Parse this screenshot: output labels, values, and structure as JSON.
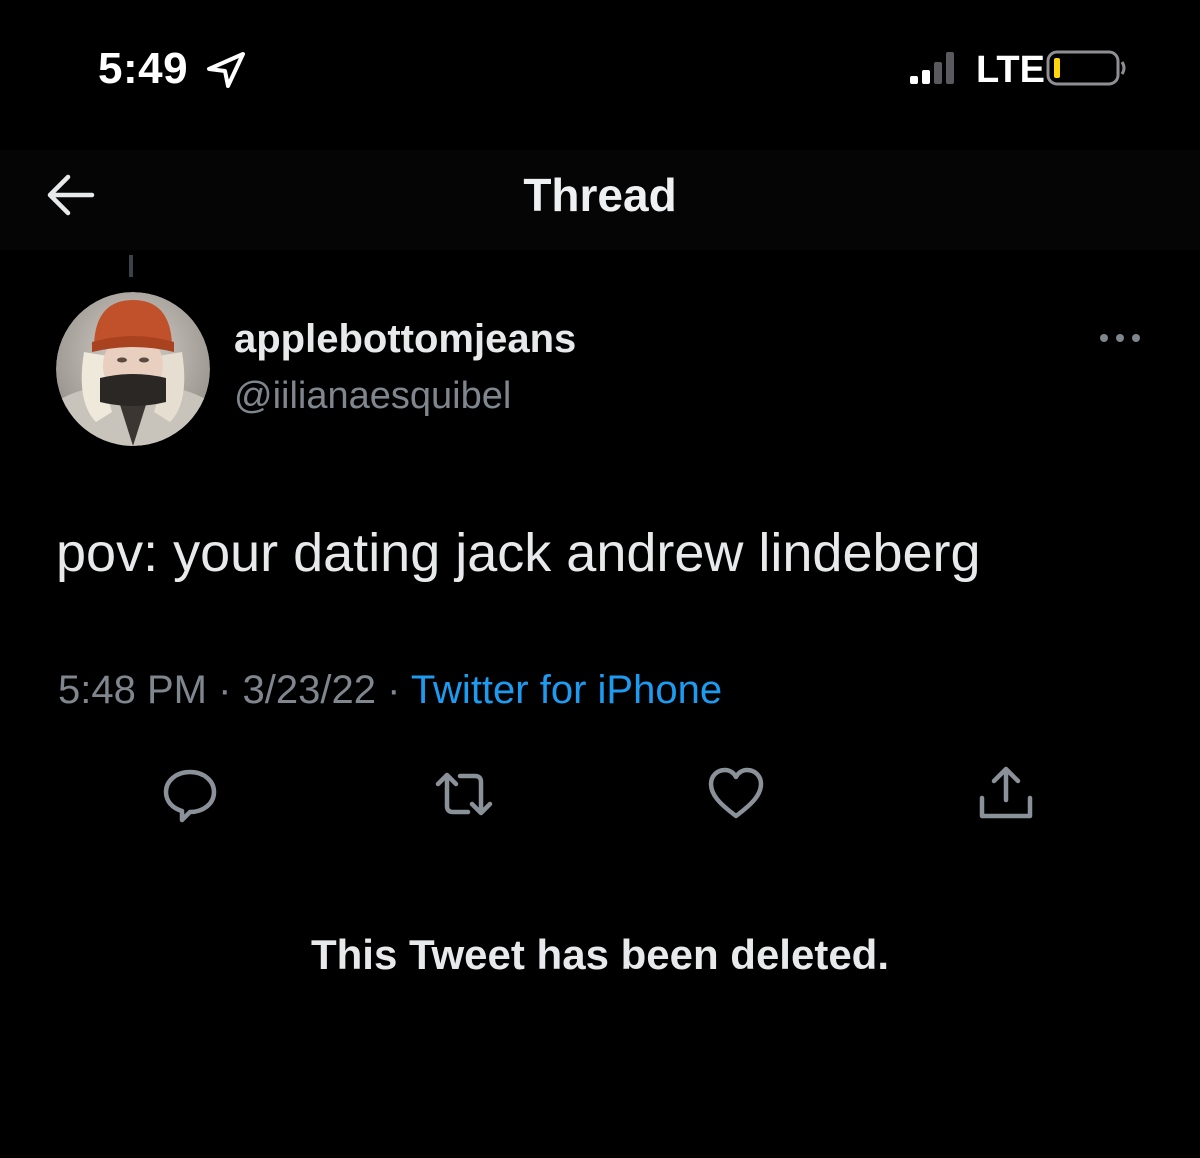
{
  "status_bar": {
    "time": "5:49",
    "network": "LTE"
  },
  "nav": {
    "title": "Thread"
  },
  "tweet": {
    "display_name": "applebottomjeans",
    "handle": "@iilianaesquibel",
    "text": "pov: your dating jack andrew lindeberg",
    "time": "5:48 PM",
    "separator": " · ",
    "date": "3/23/22",
    "source": "Twitter for iPhone"
  },
  "deleted_notice": "This Tweet has been deleted.",
  "icons": {
    "back": "arrow-left-icon",
    "more": "more-dots-icon",
    "reply": "reply-bubble-icon",
    "retweet": "retweet-icon",
    "like": "heart-icon",
    "share": "share-icon",
    "location": "location-arrow-icon",
    "signal": "signal-bars-icon",
    "battery": "battery-low-icon"
  },
  "colors": {
    "background": "#000000",
    "link": "#1d9bf0",
    "muted": "#7f868d",
    "battery_low": "#ffd60a"
  }
}
